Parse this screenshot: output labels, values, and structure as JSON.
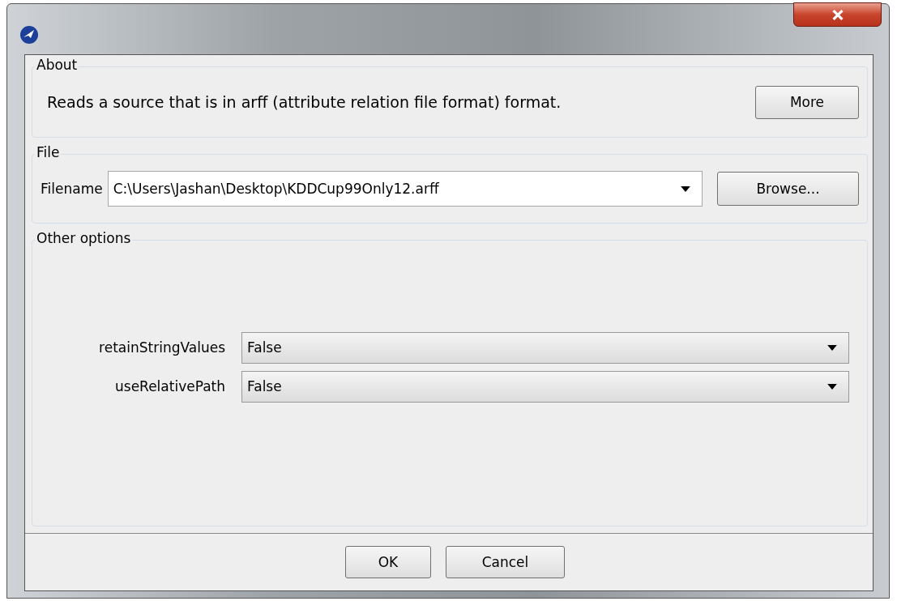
{
  "about": {
    "title": "About",
    "text": "Reads a source that is in arff (attribute relation file format) format.",
    "button": "More"
  },
  "file": {
    "title": "File",
    "label": "Filename",
    "value": "C:\\Users\\Jashan\\Desktop\\KDDCup99Only12.arff",
    "button": "Browse..."
  },
  "other_options": {
    "title": "Other options",
    "options": [
      {
        "label": "retainStringValues",
        "value": "False"
      },
      {
        "label": "useRelativePath",
        "value": "False"
      }
    ]
  },
  "buttons": [
    "OK",
    "Cancel"
  ]
}
